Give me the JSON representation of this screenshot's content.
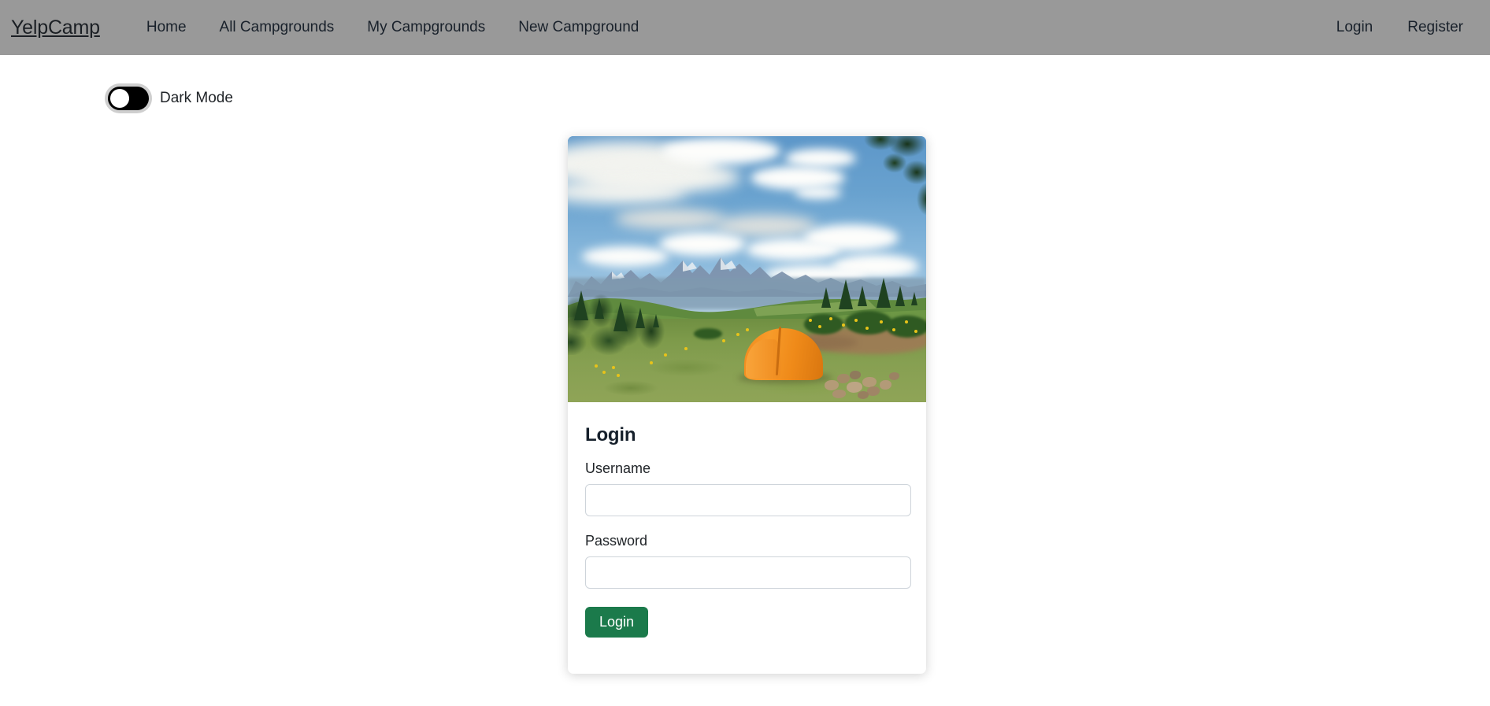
{
  "navbar": {
    "brand": "YelpCamp",
    "left_links": [
      {
        "label": "Home",
        "name": "nav-link-home"
      },
      {
        "label": "All Campgrounds",
        "name": "nav-link-all-campgrounds"
      },
      {
        "label": "My Campgrounds",
        "name": "nav-link-my-campgrounds"
      },
      {
        "label": "New Campground",
        "name": "nav-link-new-campground"
      }
    ],
    "right_links": [
      {
        "label": "Login",
        "name": "nav-link-login"
      },
      {
        "label": "Register",
        "name": "nav-link-register"
      }
    ],
    "background_color": "#999999",
    "text_color": "#19212b"
  },
  "dark_mode": {
    "label": "Dark Mode",
    "state": "off",
    "track_color": "#000000",
    "knob_color": "#ffffff",
    "ring_color": "#cfcfcf"
  },
  "card": {
    "image_alt": "Orange dome tent pitched on a grassy ridge with mountain range and cloudy blue sky",
    "title": "Login",
    "fields": [
      {
        "label": "Username",
        "name": "username-field",
        "value": "",
        "placeholder": "",
        "type": "text"
      },
      {
        "label": "Password",
        "name": "password-field",
        "value": "",
        "placeholder": "",
        "type": "password"
      }
    ],
    "submit": {
      "label": "Login",
      "color": "#1b7a4b",
      "text_color": "#ffffff"
    }
  },
  "page": {
    "background_color": "#ffffff"
  }
}
